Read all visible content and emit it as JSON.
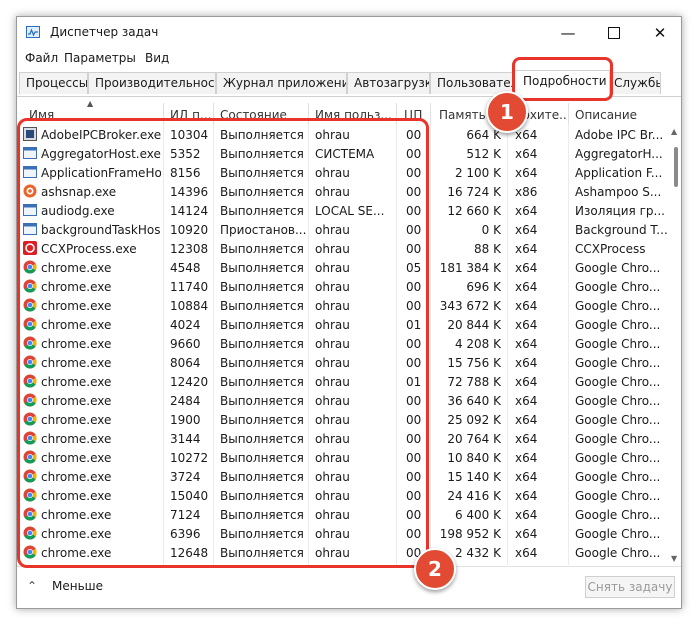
{
  "window": {
    "title": "Диспетчер задач"
  },
  "menu": [
    "Файл",
    "Параметры",
    "Вид"
  ],
  "tabs": [
    {
      "label": "Процессы",
      "active": false
    },
    {
      "label": "Производительность",
      "active": false
    },
    {
      "label": "Журнал приложений",
      "active": false
    },
    {
      "label": "Автозагрузка",
      "active": false
    },
    {
      "label": "Пользователи",
      "active": false
    },
    {
      "label": "Подробности",
      "active": true
    },
    {
      "label": "Службы",
      "active": false
    }
  ],
  "columns": [
    "Имя",
    "ИД п...",
    "Состояние",
    "Имя польз...",
    "ЦП",
    "Память ...",
    "Архите...",
    "Описание"
  ],
  "rows": [
    {
      "name": "AdobeIPCBroker.exe",
      "pid": "10304",
      "status": "Выполняется",
      "user": "ohrau",
      "cpu": "00",
      "mem": "664 K",
      "arch": "x64",
      "desc": "Adobe IPC Br...",
      "icon": "adobe-ipc-icon"
    },
    {
      "name": "AggregatorHost.exe",
      "pid": "5352",
      "status": "Выполняется",
      "user": "СИСТЕМА",
      "cpu": "00",
      "mem": "512 K",
      "arch": "x64",
      "desc": "AggregatorH...",
      "icon": "window-app-icon"
    },
    {
      "name": "ApplicationFrameHo...",
      "pid": "8156",
      "status": "Выполняется",
      "user": "ohrau",
      "cpu": "00",
      "mem": "2 100 K",
      "arch": "x64",
      "desc": "Application F...",
      "icon": "window-app-icon"
    },
    {
      "name": "ashsnap.exe",
      "pid": "14396",
      "status": "Выполняется",
      "user": "ohrau",
      "cpu": "00",
      "mem": "16 724 K",
      "arch": "x86",
      "desc": "Ashampoo S...",
      "icon": "ashampoo-icon"
    },
    {
      "name": "audiodg.exe",
      "pid": "14124",
      "status": "Выполняется",
      "user": "LOCAL SE...",
      "cpu": "00",
      "mem": "12 660 K",
      "arch": "x64",
      "desc": "Изоляция гр...",
      "icon": "window-app-icon"
    },
    {
      "name": "backgroundTaskHos...",
      "pid": "10920",
      "status": "Приостанов...",
      "user": "ohrau",
      "cpu": "00",
      "mem": "0 K",
      "arch": "x64",
      "desc": "Background T...",
      "icon": "window-app-icon"
    },
    {
      "name": "CCXProcess.exe",
      "pid": "12308",
      "status": "Выполняется",
      "user": "ohrau",
      "cpu": "00",
      "mem": "88 K",
      "arch": "x64",
      "desc": "CCXProcess",
      "icon": "adobe-cc-icon"
    },
    {
      "name": "chrome.exe",
      "pid": "4548",
      "status": "Выполняется",
      "user": "ohrau",
      "cpu": "05",
      "mem": "181 384 K",
      "arch": "x64",
      "desc": "Google Chro...",
      "icon": "chrome-icon"
    },
    {
      "name": "chrome.exe",
      "pid": "11740",
      "status": "Выполняется",
      "user": "ohrau",
      "cpu": "00",
      "mem": "696 K",
      "arch": "x64",
      "desc": "Google Chro...",
      "icon": "chrome-icon"
    },
    {
      "name": "chrome.exe",
      "pid": "10884",
      "status": "Выполняется",
      "user": "ohrau",
      "cpu": "00",
      "mem": "343 672 K",
      "arch": "x64",
      "desc": "Google Chro...",
      "icon": "chrome-icon"
    },
    {
      "name": "chrome.exe",
      "pid": "4024",
      "status": "Выполняется",
      "user": "ohrau",
      "cpu": "01",
      "mem": "20 844 K",
      "arch": "x64",
      "desc": "Google Chro...",
      "icon": "chrome-icon"
    },
    {
      "name": "chrome.exe",
      "pid": "9660",
      "status": "Выполняется",
      "user": "ohrau",
      "cpu": "00",
      "mem": "4 208 K",
      "arch": "x64",
      "desc": "Google Chro...",
      "icon": "chrome-icon"
    },
    {
      "name": "chrome.exe",
      "pid": "8064",
      "status": "Выполняется",
      "user": "ohrau",
      "cpu": "00",
      "mem": "15 756 K",
      "arch": "x64",
      "desc": "Google Chro...",
      "icon": "chrome-icon"
    },
    {
      "name": "chrome.exe",
      "pid": "12420",
      "status": "Выполняется",
      "user": "ohrau",
      "cpu": "01",
      "mem": "72 788 K",
      "arch": "x64",
      "desc": "Google Chro...",
      "icon": "chrome-icon"
    },
    {
      "name": "chrome.exe",
      "pid": "2484",
      "status": "Выполняется",
      "user": "ohrau",
      "cpu": "00",
      "mem": "36 640 K",
      "arch": "x64",
      "desc": "Google Chro...",
      "icon": "chrome-icon"
    },
    {
      "name": "chrome.exe",
      "pid": "1900",
      "status": "Выполняется",
      "user": "ohrau",
      "cpu": "00",
      "mem": "25 092 K",
      "arch": "x64",
      "desc": "Google Chro...",
      "icon": "chrome-icon"
    },
    {
      "name": "chrome.exe",
      "pid": "3144",
      "status": "Выполняется",
      "user": "ohrau",
      "cpu": "00",
      "mem": "20 764 K",
      "arch": "x64",
      "desc": "Google Chro...",
      "icon": "chrome-icon"
    },
    {
      "name": "chrome.exe",
      "pid": "10272",
      "status": "Выполняется",
      "user": "ohrau",
      "cpu": "00",
      "mem": "10 840 K",
      "arch": "x64",
      "desc": "Google Chro...",
      "icon": "chrome-icon"
    },
    {
      "name": "chrome.exe",
      "pid": "3724",
      "status": "Выполняется",
      "user": "ohrau",
      "cpu": "00",
      "mem": "15 140 K",
      "arch": "x64",
      "desc": "Google Chro...",
      "icon": "chrome-icon"
    },
    {
      "name": "chrome.exe",
      "pid": "15040",
      "status": "Выполняется",
      "user": "ohrau",
      "cpu": "00",
      "mem": "24 416 K",
      "arch": "x64",
      "desc": "Google Chro...",
      "icon": "chrome-icon"
    },
    {
      "name": "chrome.exe",
      "pid": "7124",
      "status": "Выполняется",
      "user": "ohrau",
      "cpu": "00",
      "mem": "6 400 K",
      "arch": "x64",
      "desc": "Google Chro...",
      "icon": "chrome-icon"
    },
    {
      "name": "chrome.exe",
      "pid": "6396",
      "status": "Выполняется",
      "user": "ohrau",
      "cpu": "00",
      "mem": "198 952 K",
      "arch": "x64",
      "desc": "Google Chro...",
      "icon": "chrome-icon"
    },
    {
      "name": "chrome.exe",
      "pid": "12648",
      "status": "Выполняется",
      "user": "ohrau",
      "cpu": "00",
      "mem": "2 432 K",
      "arch": "x64",
      "desc": "Google Chro...",
      "icon": "chrome-icon"
    }
  ],
  "footer": {
    "less_label": "Меньше",
    "end_task_label": "Снять задачу"
  },
  "annotations": [
    {
      "label": "1"
    },
    {
      "label": "2"
    }
  ],
  "colors": {
    "highlight": "#e8342a",
    "badge": "#e24a34",
    "chrome_red": "#db4437",
    "chrome_green": "#0f9d58",
    "chrome_yellow": "#f4b400",
    "chrome_blue": "#4285f4"
  }
}
